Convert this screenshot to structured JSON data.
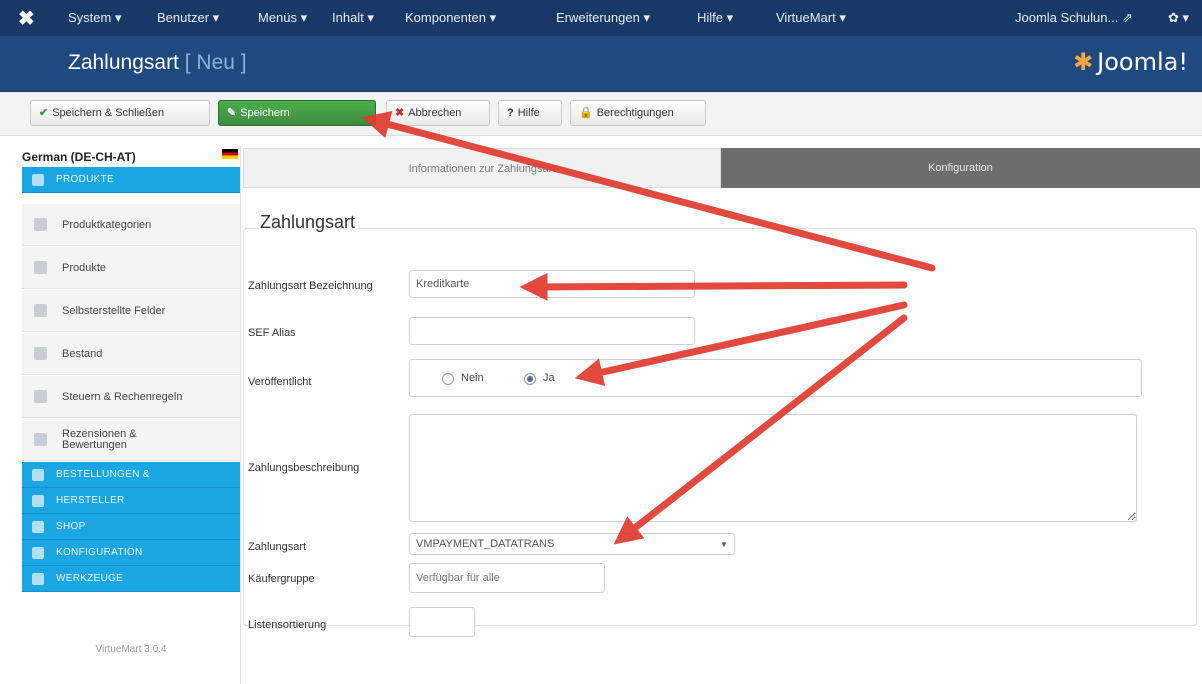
{
  "topnav": {
    "logo": "✖",
    "menu": [
      "System ▾",
      "Benutzer ▾",
      "Menüs ▾",
      "Inhalt ▾",
      "Komponenten ▾",
      "Erweiterungen ▾",
      "Hilfe ▾",
      "VirtueMart ▾"
    ],
    "site": "Joomla Schulun... ⇗",
    "settings": "✿ ▾"
  },
  "header": {
    "title": "Zahlungsart",
    "subtitle": "[ Neu ]",
    "brand": "Joomla!"
  },
  "toolbar": {
    "save_close": "Speichern & Schließen",
    "save": "Speichern",
    "cancel": "Abbrechen",
    "help": "Hilfe",
    "permissions": "Berechtigungen"
  },
  "sidebar": {
    "language": "German (DE-CH-AT)",
    "products_header": "PRODUKTE",
    "items": [
      "Produktkategorien",
      "Produkte",
      "Selbsterstellte Felder",
      "Bestand",
      "Steuern & Rechenregeln",
      "Rezensionen & Bewertungen"
    ],
    "sections": [
      "BESTELLUNGEN &",
      "HERSTELLER",
      "SHOP",
      "KONFIGURATION",
      "WERKZEUGE"
    ],
    "version": "VirtueMart 3.0.4"
  },
  "tabs": {
    "info": "Informationen zur Zahlungsart",
    "config": "Konfiguration"
  },
  "form": {
    "legend": "Zahlungsart",
    "name_label": "Zahlungsart Bezeichnung",
    "name_value": "Kreditkarte",
    "alias_label": "SEF Alias",
    "alias_value": "",
    "published_label": "Veröffentlicht",
    "no": "Nein",
    "yes": "Ja",
    "description_label": "Zahlungsbeschreibung",
    "method_label": "Zahlungsart",
    "method_value": "VMPAYMENT_DATATRANS",
    "group_label": "Käufergruppe",
    "group_placeholder": "Verfügbar für alle",
    "order_label": "Listensortierung",
    "order_value": ""
  }
}
